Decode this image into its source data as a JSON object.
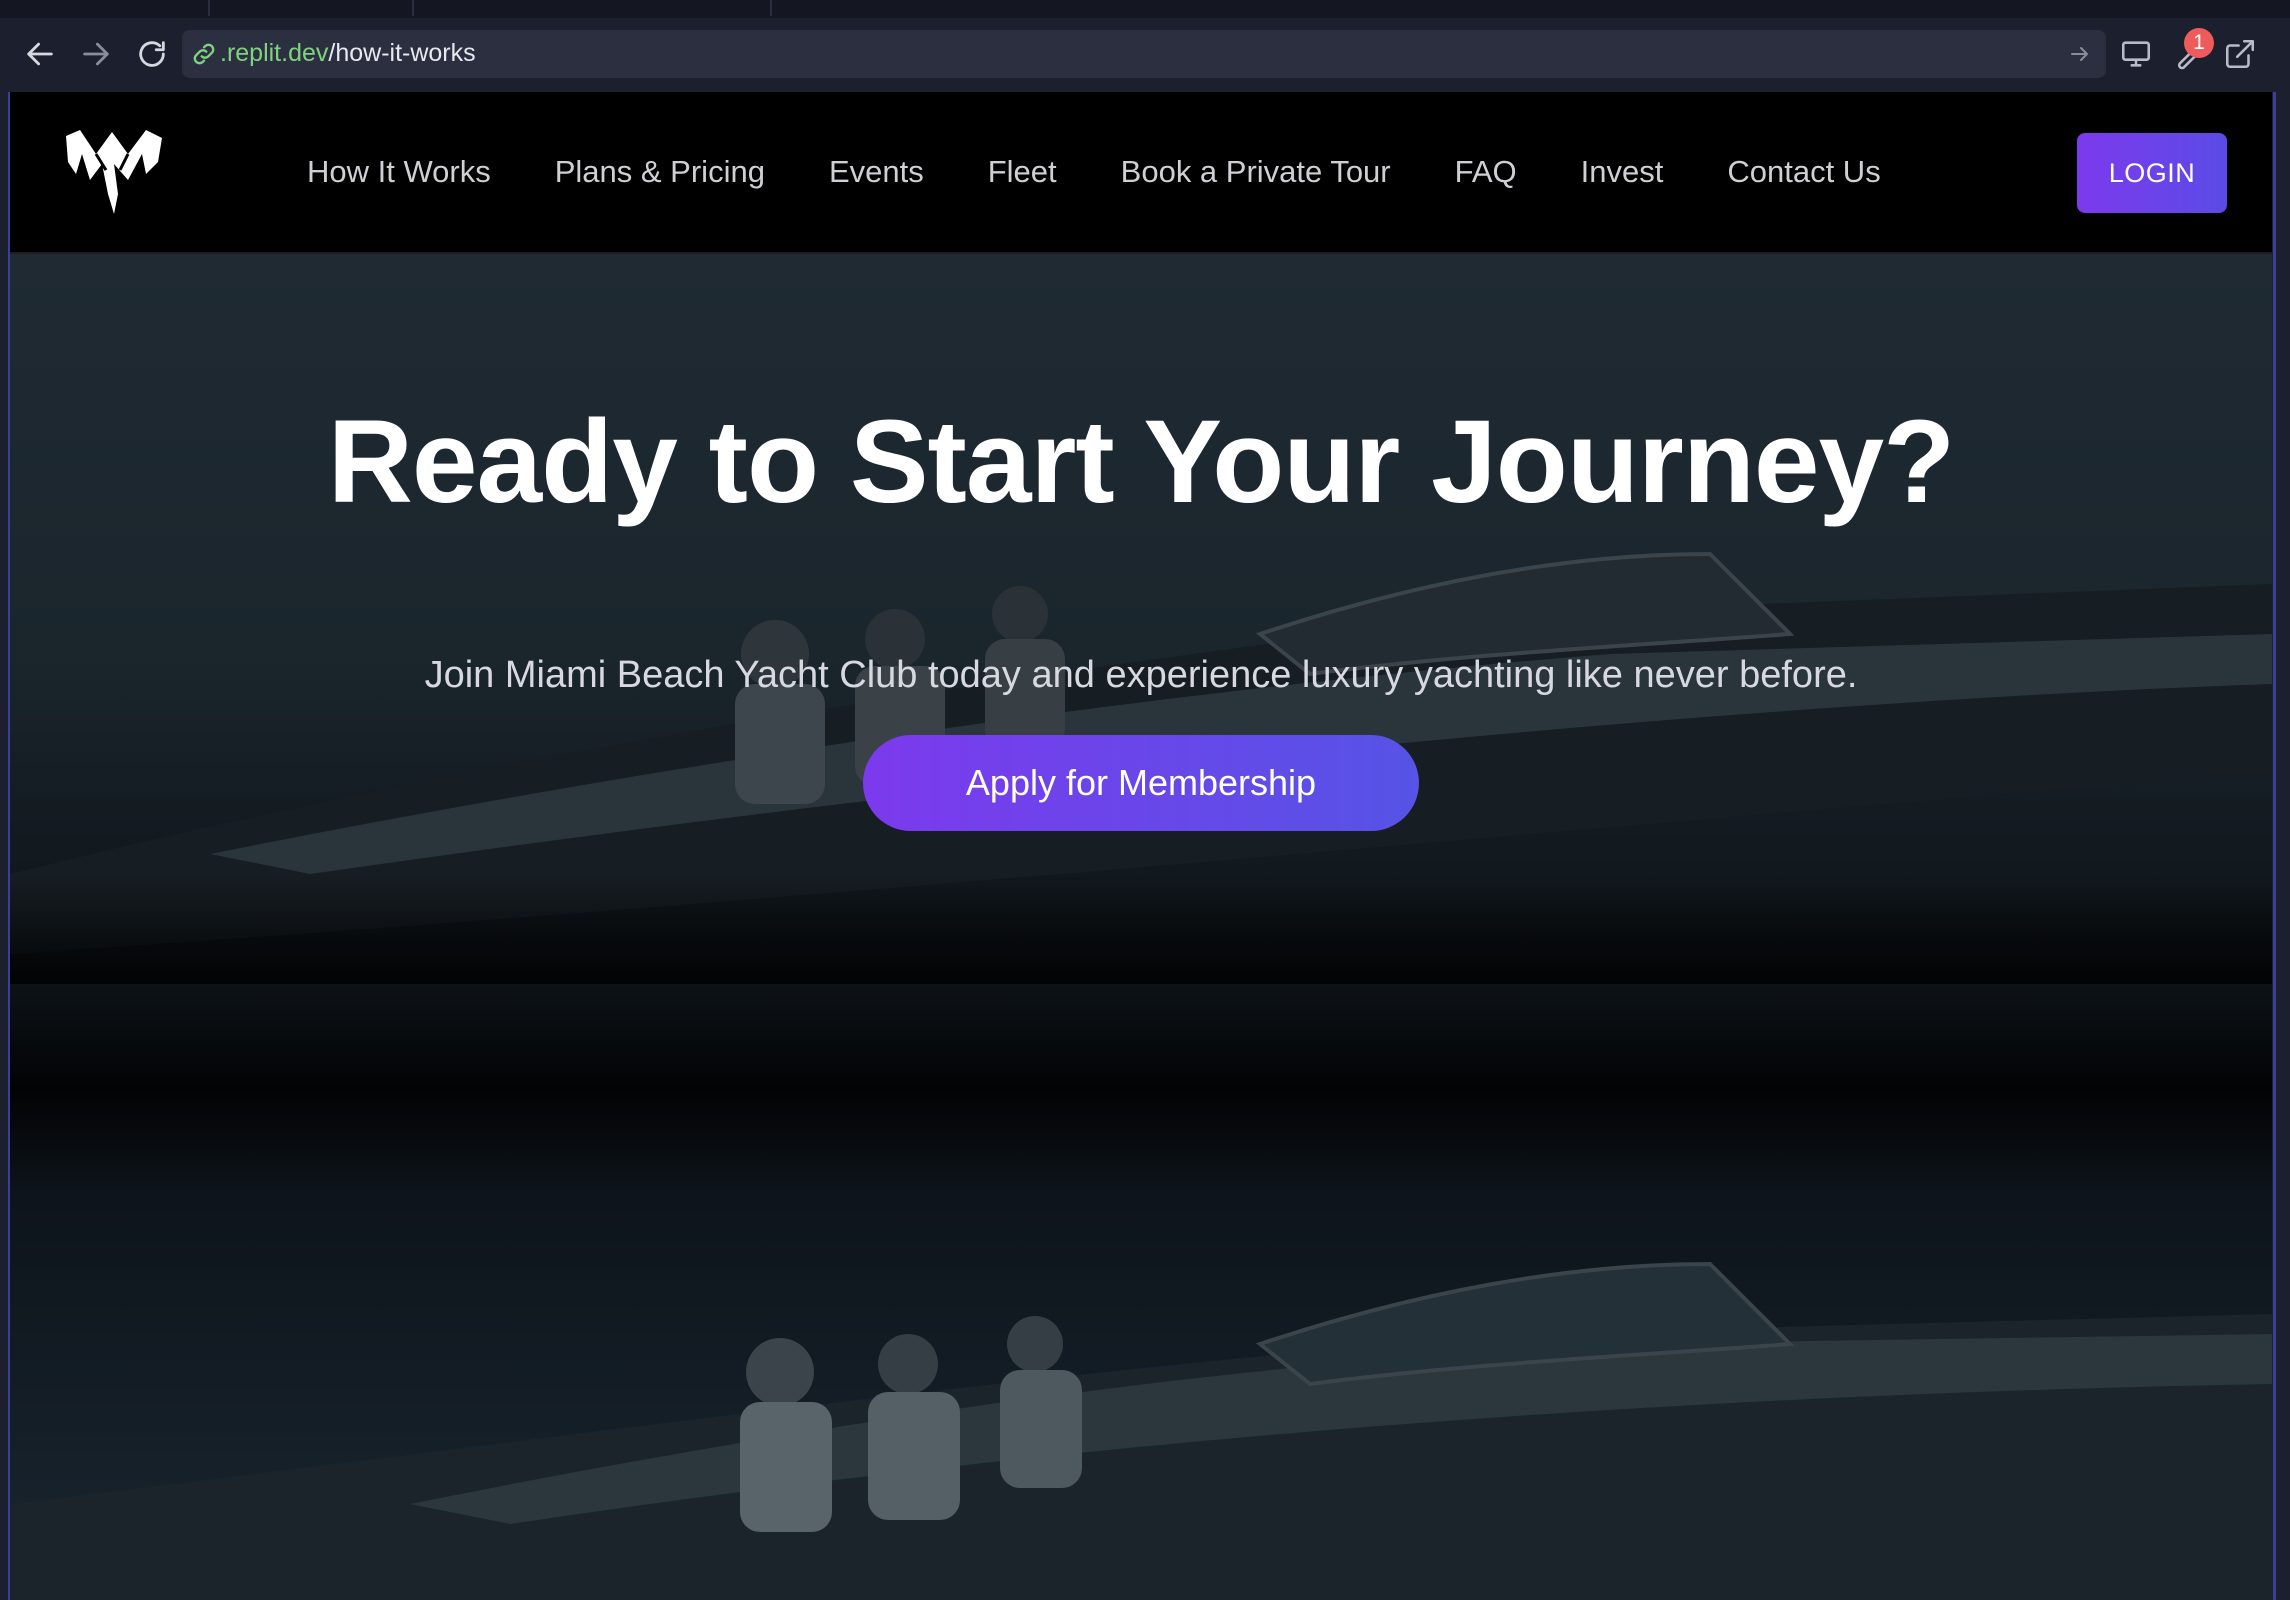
{
  "browser": {
    "url_host": ".replit.dev",
    "url_path": "/how-it-works",
    "notification_count": "1",
    "icons": [
      "back-icon",
      "forward-icon",
      "reload-icon",
      "link-icon",
      "go-icon",
      "monitor-icon",
      "tools-icon",
      "open-external-icon"
    ]
  },
  "navbar": {
    "logo_icon": "yacht-club-logo",
    "links": [
      "How It Works",
      "Plans & Pricing",
      "Events",
      "Fleet",
      "Book a Private Tour",
      "FAQ",
      "Invest",
      "Contact Us"
    ],
    "login_label": "LOGIN"
  },
  "hero": {
    "title": "Ready to Start Your Journey?",
    "subtitle": "Join Miami Beach Yacht Club today and experience luxury yachting like never before.",
    "cta_label": "Apply for Membership"
  },
  "colors": {
    "accent": "#7c3aed",
    "accent_end": "#5653e6",
    "nav_background": "#000000",
    "chrome_background": "#1c1f2e",
    "url_host_green": "#7fd27f",
    "badge_red": "#ee5b5b"
  }
}
